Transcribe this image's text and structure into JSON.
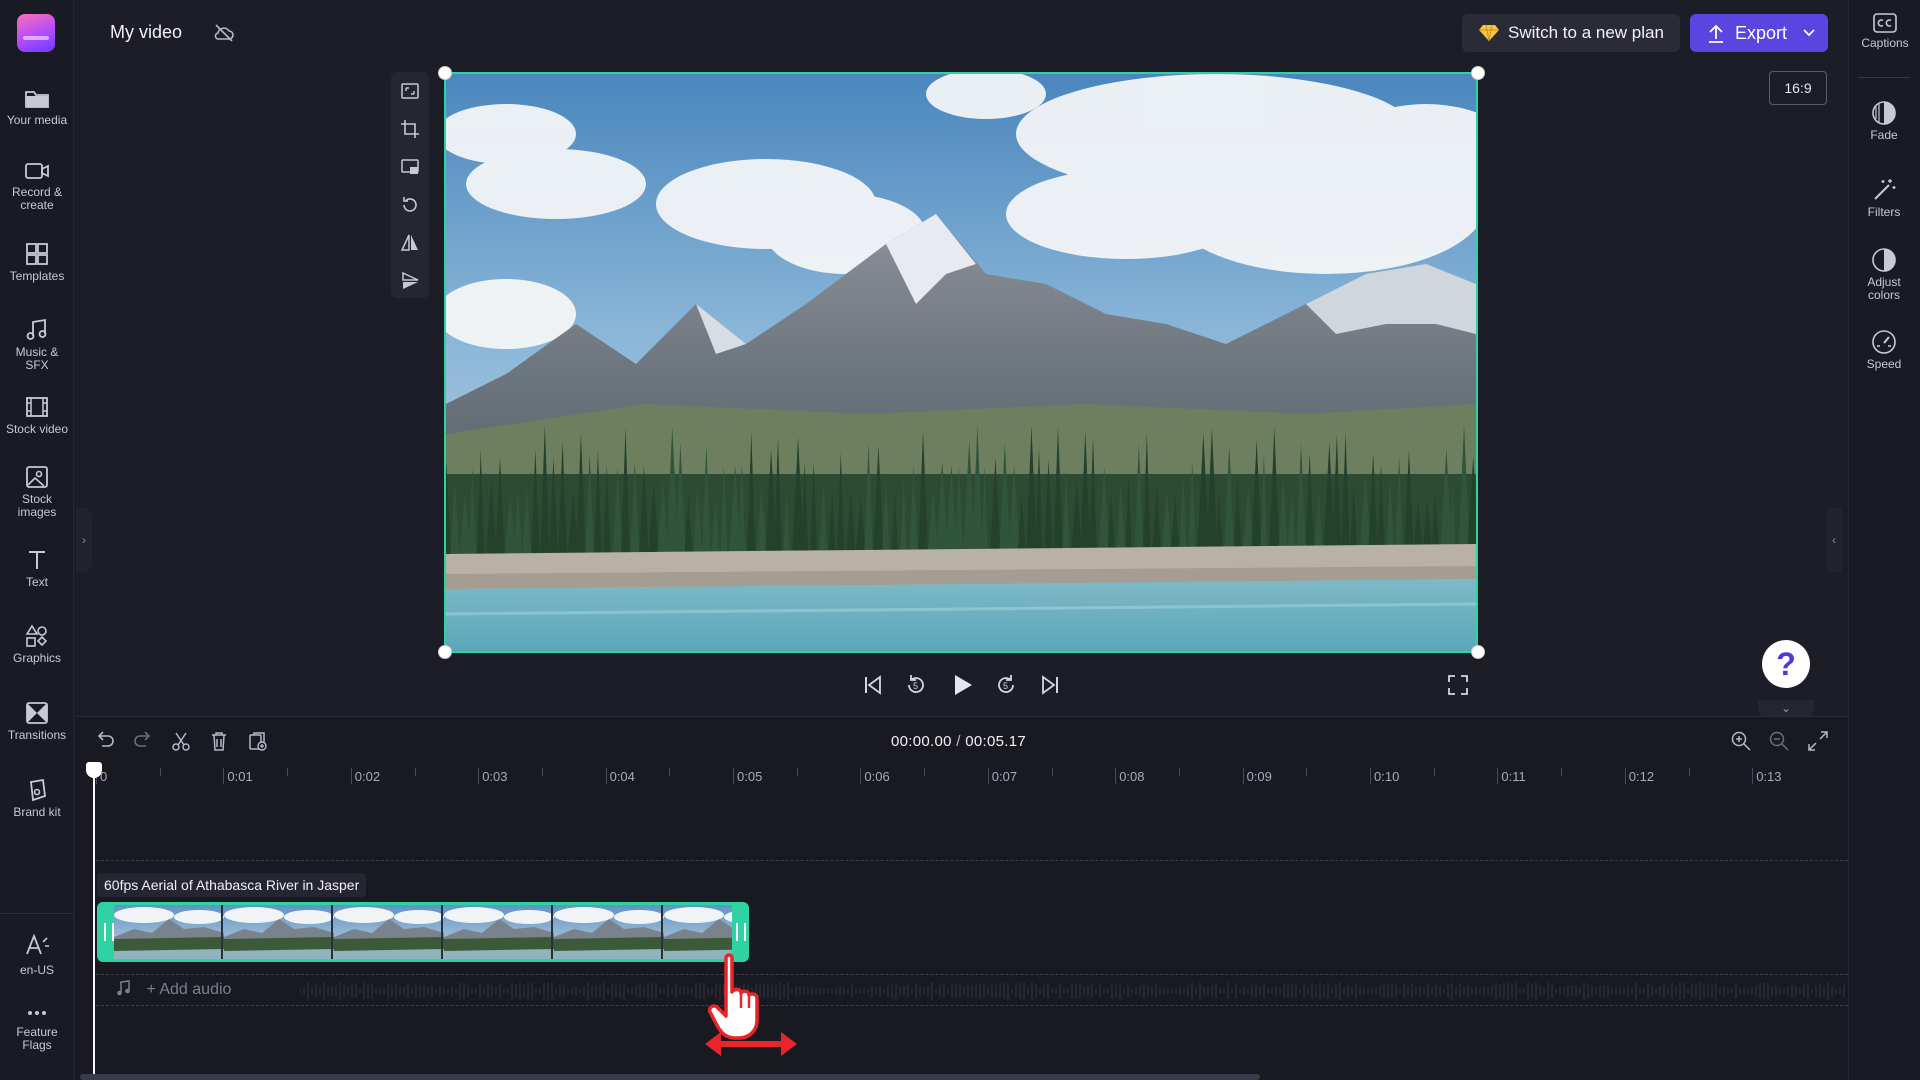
{
  "header": {
    "title": "My video",
    "upgrade_label": "Switch to a new plan",
    "export_label": "Export",
    "aspect_ratio": "16:9"
  },
  "left_nav": {
    "items": [
      {
        "label": "Your media",
        "icon": "folder-icon"
      },
      {
        "label": "Record & create",
        "icon": "camera-icon"
      },
      {
        "label": "Templates",
        "icon": "templates-icon"
      },
      {
        "label": "Music & SFX",
        "icon": "music-icon"
      },
      {
        "label": "Stock video",
        "icon": "film-icon"
      },
      {
        "label": "Stock images",
        "icon": "image-icon"
      },
      {
        "label": "Text",
        "icon": "text-icon"
      },
      {
        "label": "Graphics",
        "icon": "shapes-icon"
      },
      {
        "label": "Transitions",
        "icon": "transitions-icon"
      },
      {
        "label": "Brand kit",
        "icon": "brand-kit-icon"
      }
    ],
    "bottom": [
      {
        "label": "en-US",
        "icon": "language-icon"
      },
      {
        "label": "Feature Flags",
        "icon": "more-icon"
      }
    ]
  },
  "right_panel": {
    "items": [
      {
        "label": "Captions",
        "icon": "captions-icon"
      },
      {
        "label": "Fade",
        "icon": "fade-icon"
      },
      {
        "label": "Filters",
        "icon": "magic-wand-icon"
      },
      {
        "label": "Adjust colors",
        "icon": "contrast-icon"
      },
      {
        "label": "Speed",
        "icon": "speedometer-icon"
      }
    ]
  },
  "timeline": {
    "current_time": "00:00.00",
    "separator": "/",
    "total_time": "00:05.17",
    "ruler_ticks": [
      "0",
      "0:01",
      "0:02",
      "0:03",
      "0:04",
      "0:05",
      "0:06",
      "0:07",
      "0:08",
      "0:09",
      "0:10",
      "0:11",
      "0:12",
      "0:13"
    ],
    "clip_title": "60fps Aerial of Athabasca River in Jasper",
    "add_audio_label": "+ Add audio"
  },
  "colors": {
    "accent": "#5b45e0",
    "selection": "#2fd3a2",
    "background": "#1d1d27",
    "annotation": "#e8262a"
  }
}
